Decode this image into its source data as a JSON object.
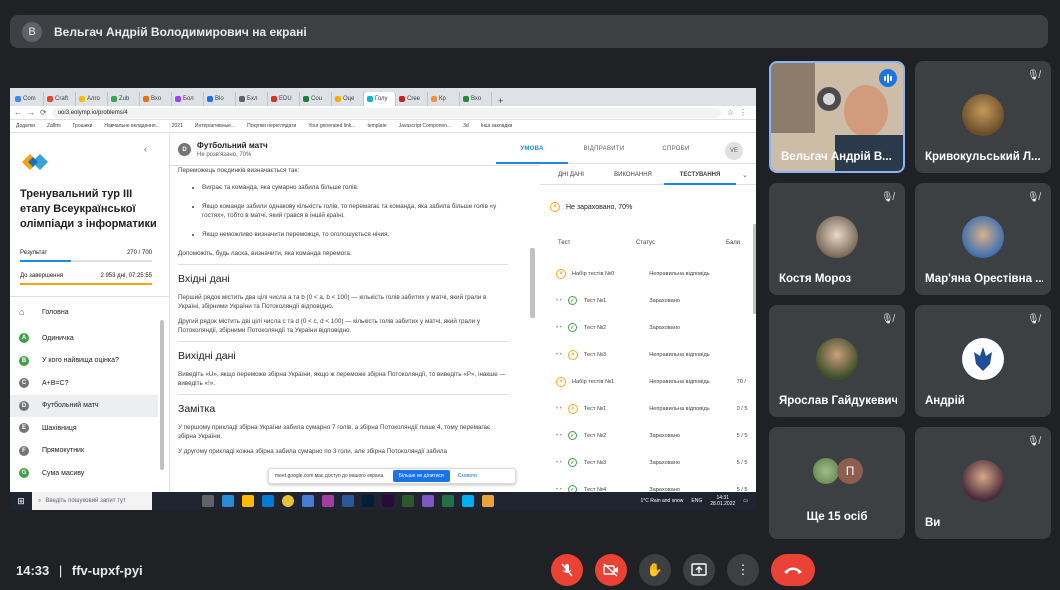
{
  "meet": {
    "presenter_initial": "В",
    "presenter_banner": "Вельгач Андрій Володимирович на екрані",
    "time": "14:33",
    "separator": "|",
    "meeting_code": "ffv-upxf-pyi"
  },
  "participants": [
    {
      "name": "Вельгач Андрій В...",
      "muted": false,
      "speaking": true
    },
    {
      "name": "Кривокульський Л...",
      "muted": true
    },
    {
      "name": "Костя Мороз",
      "muted": true
    },
    {
      "name": "Мар'яна Орестівна ...",
      "muted": true
    },
    {
      "name": "Ярослав Гайдукевич",
      "muted": true
    },
    {
      "name": "Андрій",
      "muted": true
    },
    {
      "name": "Ще 15 осіб",
      "initial": "П"
    },
    {
      "name": "Ви",
      "muted": true
    }
  ],
  "browser": {
    "tabs": [
      "Com",
      "Craft",
      "Алго",
      "Zub",
      "Вхо",
      "Бол",
      "Blo",
      "Бхл",
      "EDU",
      "Cou",
      "Оце",
      "Голу",
      "Cree",
      "Кр",
      "Вхо"
    ],
    "url": "uoi3.eolymp.io/problems/4",
    "bookmarks": [
      "Додатки",
      "Zalfmi",
      "Грошики",
      "Навчальне вкладення...",
      "2021",
      "Интерактивные...",
      "Покупки переглядати",
      "Your generated link...",
      "template",
      "Javascript Componen...",
      "3d",
      "Інші закладки"
    ]
  },
  "eolymp": {
    "sidebar_title": "Тренувальний тур ІІІ етапу Всеукраїнської олімпіади з інформатики",
    "result_label": "Результат",
    "result_value": "270 / 700",
    "end_label": "До завершення",
    "end_value": "2 953 дні, 07:25:55",
    "menu_home": "Головна",
    "menu": [
      {
        "letter": "A",
        "label": "Одиничка",
        "color": "#43a047"
      },
      {
        "letter": "B",
        "label": "У кого найвища оцінка?",
        "color": "#43a047"
      },
      {
        "letter": "C",
        "label": "A+B=C?",
        "color": "#757575"
      },
      {
        "letter": "D",
        "label": "Футбольний матч",
        "color": "#757575"
      },
      {
        "letter": "E",
        "label": "Шахівниця",
        "color": "#757575"
      },
      {
        "letter": "F",
        "label": "Прямокутник",
        "color": "#757575"
      },
      {
        "letter": "G",
        "label": "Сума масиву",
        "color": "#43a047"
      }
    ],
    "problem_letter": "D",
    "problem_title": "Футбольний матч",
    "problem_status": "Не розв'язано, 70%",
    "p_intro": "Переможець поєдинків визначається так:",
    "bullets": [
      "Виграє та команда, яка сумарно забила більше голів.",
      "Якщо команди забили однакову кількість голів, то перемагає та команда, яка забила більше голів «у гостях», тобто в матчі, який грався в іншій країні.",
      "Якщо неможливо визначити переможця, то оголошується нічия."
    ],
    "p_help": "Допоможіть, будь ласка, визначити, яка команда перемога.",
    "input_title": "Вхідні дані",
    "input_p1": "Перший рядок містить два цілі числа a та b (0 < a, b < 100) — кількість голів забитих у матчі, який грали в Україні, збірними України та Потоколяндії відповідно.",
    "input_p2": "Другий рядок містить дві цілі числа c та d (0 < c, d < 100) — кількість голів забитих у матчі, який грали у Потоколяндії, збірними Потоколяндії та України відповідно.",
    "output_title": "Вихідні дані",
    "output_p": "Виведіть «U», якщо переможе збірна України, якщо ж переможе збірна Потоколяндії, то виведіть «P», інакше — виведіть «!».",
    "note_title": "Замітка",
    "note_p1": "У першому прикладі збірна України забила сумарно 7 голів, а збірна Потоколяндії лише 4, тому перемагає збірна України.",
    "note_p2": "У другому прикладі кожна збірна забила сумарно по 3 голи, але збірна Потоколяндії забила",
    "notif_text": "meet.google.com має доступ до вашого екрана.",
    "notif_btn": "Більше не ділитися",
    "notif_hide": "Сховати",
    "tabs": [
      "УМОВА",
      "ВІДПРАВИТИ",
      "СПРОБИ"
    ],
    "user_initials": "VE",
    "subtabs": [
      "ДНІ ДАНІ",
      "ВИКОНАННЯ",
      "ТЕСТУВАННЯ"
    ],
    "verdict": "Не зараховано, 70%",
    "col_test": "Тест",
    "col_status": "Статус",
    "col_points": "Бали",
    "rows": [
      {
        "kind": "group",
        "icon": "x",
        "test": "Набір тестів №0",
        "status": "Неправильна відповідь",
        "pts": ""
      },
      {
        "kind": "item",
        "icon": "ok",
        "test": "Тест №1",
        "status": "Зараховано",
        "pts": ""
      },
      {
        "kind": "item",
        "icon": "ok",
        "test": "Тест №2",
        "status": "Зараховано",
        "pts": ""
      },
      {
        "kind": "item",
        "icon": "x",
        "test": "Тест №3",
        "status": "Неправильна відповідь",
        "pts": ""
      },
      {
        "kind": "group",
        "icon": "x",
        "test": "Набір тестів №1",
        "status": "Неправильна відповідь",
        "pts": "70 /"
      },
      {
        "kind": "item",
        "icon": "x",
        "test": "Тест №1",
        "status": "Неправильна відповідь",
        "pts": "0 / 5"
      },
      {
        "kind": "item",
        "icon": "ok",
        "test": "Тест №2",
        "status": "Зараховано",
        "pts": "5 / 5"
      },
      {
        "kind": "item",
        "icon": "ok",
        "test": "Тест №3",
        "status": "Зараховано",
        "pts": "5 / 5"
      },
      {
        "kind": "item",
        "icon": "ok",
        "test": "Тест №4",
        "status": "Зараховано",
        "pts": "5 / 5"
      }
    ]
  },
  "taskbar": {
    "search_placeholder": "Введіть пошуковий запит тут",
    "weather": "1°C Rain and snow",
    "lang": "ENG",
    "time": "14:31",
    "date": "28.01.2022"
  },
  "colors": {
    "meet_bg": "#202124",
    "tile_bg": "#3c4043",
    "red": "#ea4335",
    "accent": "#1a73e8"
  }
}
